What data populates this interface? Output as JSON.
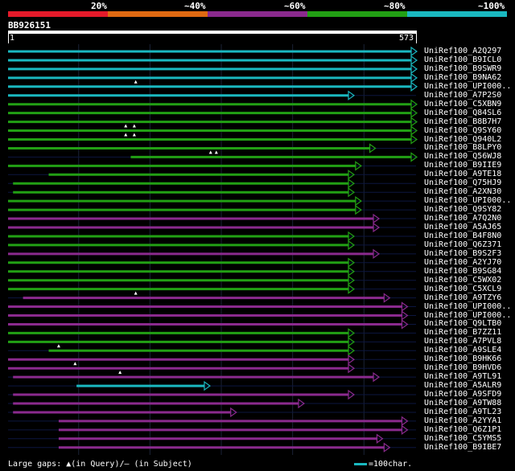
{
  "legend": {
    "labels": [
      "20%",
      "~40%",
      "~60%",
      "~80%",
      "~100%"
    ],
    "colors": [
      "#e51a2a",
      "#e06a12",
      "#8b2a8e",
      "#22a014",
      "#1ab8c0"
    ]
  },
  "query": {
    "name": "BB926151",
    "start": "1",
    "end": "573"
  },
  "footer": {
    "gaps_text": "Large gaps: ▲(in Query)/— (in Subject)",
    "scale_text": "=100char.",
    "scale_color": "#1ab8c0"
  },
  "grid_color": "#1a2236",
  "hits": [
    {
      "label": "UniRef100_A2Q297",
      "start": 1,
      "end": 573,
      "color": "cyan"
    },
    {
      "label": "UniRef100_B9ICL0",
      "start": 1,
      "end": 573,
      "color": "cyan"
    },
    {
      "label": "UniRef100_B9SWR9",
      "start": 1,
      "end": 573,
      "color": "cyan"
    },
    {
      "label": "UniRef100_B9NA62",
      "start": 1,
      "end": 573,
      "color": "cyan"
    },
    {
      "label": "UniRef100_UPI000..",
      "start": 1,
      "end": 573,
      "color": "cyan",
      "gap": [
        180
      ]
    },
    {
      "label": "UniRef100_A7P2S0",
      "start": 1,
      "end": 485,
      "color": "cyan"
    },
    {
      "label": "UniRef100_C5XBN9",
      "start": 1,
      "end": 573,
      "color": "green"
    },
    {
      "label": "UniRef100_Q84SL6",
      "start": 1,
      "end": 573,
      "color": "green"
    },
    {
      "label": "UniRef100_B8B7H7",
      "start": 1,
      "end": 573,
      "color": "green"
    },
    {
      "label": "UniRef100_Q9SY60",
      "start": 1,
      "end": 573,
      "color": "green",
      "gap": [
        166,
        178
      ]
    },
    {
      "label": "UniRef100_Q940L2",
      "start": 1,
      "end": 573,
      "color": "green",
      "gap": [
        166,
        178
      ]
    },
    {
      "label": "UniRef100_B8LPY0",
      "start": 1,
      "end": 515,
      "color": "green"
    },
    {
      "label": "UniRef100_Q56WJ8",
      "start": 173,
      "end": 573,
      "color": "green",
      "gap": [
        285,
        293
      ]
    },
    {
      "label": "UniRef100_B9IIE9",
      "start": 1,
      "end": 495,
      "color": "green"
    },
    {
      "label": "UniRef100_A9TE18",
      "start": 58,
      "end": 485,
      "color": "green"
    },
    {
      "label": "UniRef100_Q75HJ9",
      "start": 8,
      "end": 485,
      "color": "green"
    },
    {
      "label": "UniRef100_A2XN30",
      "start": 8,
      "end": 485,
      "color": "green"
    },
    {
      "label": "UniRef100_UPI000..",
      "start": 1,
      "end": 495,
      "color": "green"
    },
    {
      "label": "UniRef100_Q9SY82",
      "start": 1,
      "end": 495,
      "color": "green"
    },
    {
      "label": "UniRef100_A7Q2N0",
      "start": 1,
      "end": 520,
      "color": "purple"
    },
    {
      "label": "UniRef100_A5AJ65",
      "start": 1,
      "end": 520,
      "color": "purple"
    },
    {
      "label": "UniRef100_B4F8N0",
      "start": 1,
      "end": 485,
      "color": "green"
    },
    {
      "label": "UniRef100_Q6Z371",
      "start": 1,
      "end": 485,
      "color": "green"
    },
    {
      "label": "UniRef100_B9S2F3",
      "start": 1,
      "end": 520,
      "color": "purple"
    },
    {
      "label": "UniRef100_A2YJ70",
      "start": 1,
      "end": 485,
      "color": "green"
    },
    {
      "label": "UniRef100_B9SG84",
      "start": 1,
      "end": 485,
      "color": "green"
    },
    {
      "label": "UniRef100_C5WX02",
      "start": 1,
      "end": 485,
      "color": "green"
    },
    {
      "label": "UniRef100_C5XCL9",
      "start": 1,
      "end": 485,
      "color": "green"
    },
    {
      "label": "UniRef100_A9TZY6",
      "start": 22,
      "end": 535,
      "color": "purple",
      "gap": [
        180
      ]
    },
    {
      "label": "UniRef100_UPI000..",
      "start": 1,
      "end": 560,
      "color": "purple"
    },
    {
      "label": "UniRef100_UPI000..",
      "start": 1,
      "end": 560,
      "color": "purple"
    },
    {
      "label": "UniRef100_Q9LTB0",
      "start": 1,
      "end": 560,
      "color": "purple"
    },
    {
      "label": "UniRef100_B7ZZ11",
      "start": 1,
      "end": 485,
      "color": "green"
    },
    {
      "label": "UniRef100_A7PVL8",
      "start": 1,
      "end": 485,
      "color": "green"
    },
    {
      "label": "UniRef100_A9SLE4",
      "start": 58,
      "end": 485,
      "color": "green",
      "gap": [
        72
      ]
    },
    {
      "label": "UniRef100_B9HK66",
      "start": 1,
      "end": 485,
      "color": "purple"
    },
    {
      "label": "UniRef100_B9HVD6",
      "start": 1,
      "end": 485,
      "color": "purple",
      "gap": [
        95
      ]
    },
    {
      "label": "UniRef100_A9TL91",
      "start": 8,
      "end": 520,
      "color": "purple",
      "gap": [
        158
      ]
    },
    {
      "label": "UniRef100_A5ALR9",
      "start": 97,
      "end": 283,
      "color": "cyan"
    },
    {
      "label": "UniRef100_A9SFD9",
      "start": 8,
      "end": 485,
      "color": "purple"
    },
    {
      "label": "UniRef100_A9TW88",
      "start": 8,
      "end": 415,
      "color": "purple"
    },
    {
      "label": "UniRef100_A9TL23",
      "start": 8,
      "end": 320,
      "color": "purple"
    },
    {
      "label": "UniRef100_A2YYA1",
      "start": 72,
      "end": 560,
      "color": "purple"
    },
    {
      "label": "UniRef100_Q6Z1P1",
      "start": 72,
      "end": 560,
      "color": "purple"
    },
    {
      "label": "UniRef100_C5YMS5",
      "start": 72,
      "end": 525,
      "color": "purple"
    },
    {
      "label": "UniRef100_B9IBE7",
      "start": 72,
      "end": 535,
      "color": "purple"
    }
  ]
}
